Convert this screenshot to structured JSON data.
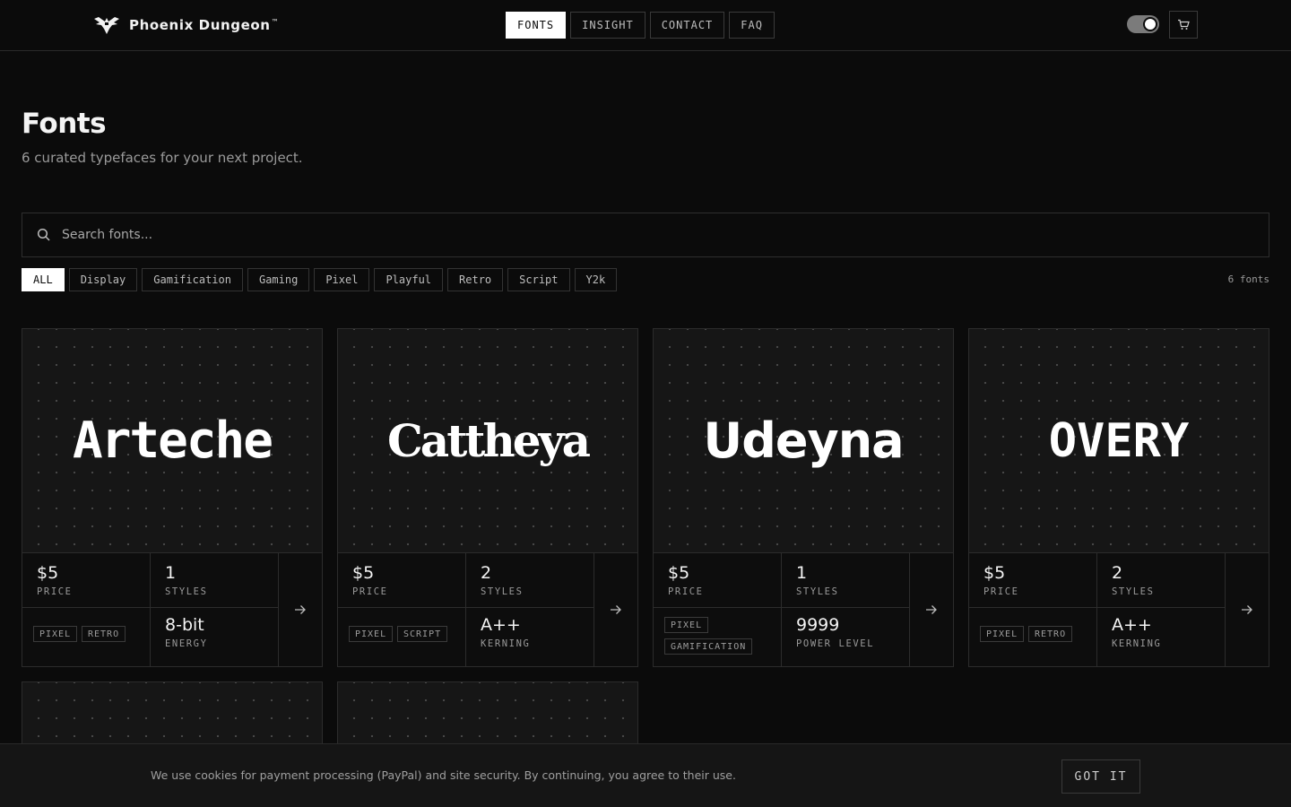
{
  "brand": {
    "name": "Phoenix Dungeon",
    "mark": "™"
  },
  "nav": [
    {
      "label": "FONTS",
      "active": true
    },
    {
      "label": "INSIGHT"
    },
    {
      "label": "CONTACT"
    },
    {
      "label": "FAQ"
    }
  ],
  "hero": {
    "title": "Fonts",
    "subtitle": "6 curated typefaces for your next project."
  },
  "search": {
    "placeholder": "Search fonts..."
  },
  "filters": [
    "ALL",
    "Display",
    "Gamification",
    "Gaming",
    "Pixel",
    "Playful",
    "Retro",
    "Script",
    "Y2k"
  ],
  "count": "6 fonts",
  "fonts": [
    {
      "name": "Arteche",
      "price": "$5",
      "price_label": "PRICE",
      "styles": "1",
      "styles_label": "STYLES",
      "tags": [
        "PIXEL",
        "RETRO"
      ],
      "stat_value": "8-bit",
      "stat_label": "ENERGY"
    },
    {
      "name": "Cattheya",
      "price": "$5",
      "price_label": "PRICE",
      "styles": "2",
      "styles_label": "STYLES",
      "tags": [
        "PIXEL",
        "SCRIPT"
      ],
      "stat_value": "A++",
      "stat_label": "KERNING"
    },
    {
      "name": "Udeyna",
      "price": "$5",
      "price_label": "PRICE",
      "styles": "1",
      "styles_label": "STYLES",
      "tags": [
        "PIXEL",
        "GAMIFICATION"
      ],
      "stat_value": "9999",
      "stat_label": "POWER LEVEL"
    },
    {
      "name": "OVERY",
      "price": "$5",
      "price_label": "PRICE",
      "styles": "2",
      "styles_label": "STYLES",
      "tags": [
        "PIXEL",
        "RETRO"
      ],
      "stat_value": "A++",
      "stat_label": "KERNING"
    }
  ],
  "cookie": {
    "text": "We use cookies for payment processing (PayPal) and site security. By continuing, you agree to their use.",
    "button": "GOT IT"
  },
  "icons": {
    "logo": "phoenix-logo",
    "search": "search-icon",
    "cart": "cart-icon",
    "arrow": "arrow-right-icon"
  },
  "colors": {
    "background": "#0b0b0b",
    "accent": "#ffffff",
    "muted": "#9a9a9a"
  }
}
